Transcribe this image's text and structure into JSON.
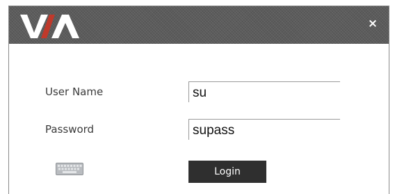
{
  "window": {
    "logo_text": "VIA",
    "close_symbol": "×"
  },
  "form": {
    "username_label": "User Name",
    "username_value": "su",
    "password_label": "Password",
    "password_value": "supass",
    "login_label": "Login"
  },
  "icons": {
    "logo": "via-logo",
    "close": "close-icon",
    "keyboard": "keyboard-icon"
  },
  "colors": {
    "titlebar": "#5c5c5c",
    "logo_accent": "#c0392b",
    "button_bg": "#2f2f2f"
  }
}
